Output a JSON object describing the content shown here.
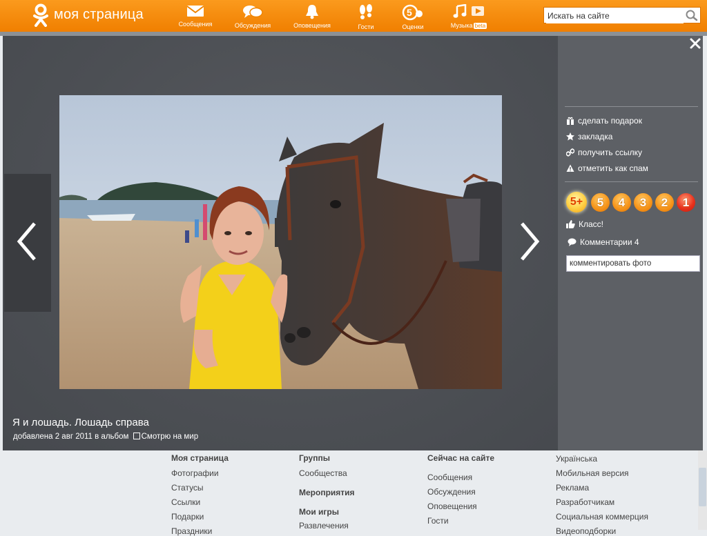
{
  "header": {
    "brand": "моя страница",
    "nav": [
      {
        "label": "Сообщения",
        "icon": "envelope-icon"
      },
      {
        "label": "Обсуждения",
        "icon": "speech-bubbles-icon"
      },
      {
        "label": "Оповещения",
        "icon": "bell-icon"
      },
      {
        "label": "Гости",
        "icon": "footprints-icon"
      },
      {
        "label": "Оценки",
        "icon": "rating-five-icon"
      },
      {
        "label": "Музыка",
        "icon": "music-note-icon",
        "badge": "beta"
      }
    ],
    "search_placeholder": "Искать на сайте",
    "accent_color": "#f59000"
  },
  "photo": {
    "title": "Я и лошадь. Лошадь справа",
    "added_prefix": "добавлена 2 авг 2011 в альбом",
    "album_name": "Смотрю на мир"
  },
  "sidebar": {
    "actions": [
      {
        "label": "сделать подарок",
        "icon": "gift-icon"
      },
      {
        "label": "закладка",
        "icon": "star-icon"
      },
      {
        "label": "получить ссылку",
        "icon": "link-icon"
      },
      {
        "label": "отметить как спам",
        "icon": "warning-icon"
      }
    ],
    "ratings": [
      "5+",
      "5",
      "4",
      "3",
      "2",
      "1"
    ],
    "like_label": "Класс!",
    "comments_label": "Комментарии 4",
    "comment_placeholder": "комментировать фото"
  },
  "footer": {
    "col1": {
      "heading": "Моя страница",
      "links": [
        "Фотографии",
        "Статусы",
        "Ссылки",
        "Подарки",
        "Праздники"
      ]
    },
    "col2": {
      "heading": "Группы",
      "links": [
        "Сообщества"
      ],
      "heading2": "Мероприятия",
      "heading3": "Мои игры",
      "links3": [
        "Развлечения"
      ]
    },
    "col3": {
      "heading": "Сейчас на сайте",
      "links": [
        "Сообщения",
        "Обсуждения",
        "Оповещения",
        "Гости"
      ]
    },
    "col4": {
      "links": [
        "Українська",
        "Мобильная версия",
        "Реклама",
        "Разработчикам",
        "Социальная коммерция",
        "Видеоподборки"
      ]
    }
  }
}
